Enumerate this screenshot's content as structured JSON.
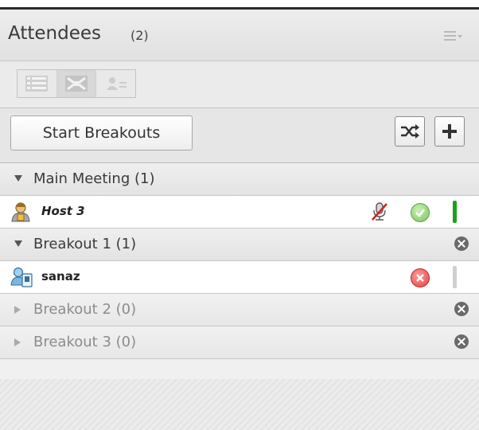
{
  "header": {
    "title": "Attendees",
    "count": "(2)",
    "menu_icon": "list-menu-icon"
  },
  "view_buttons": [
    {
      "name": "list-view-icon",
      "active": false
    },
    {
      "name": "breakout-view-icon",
      "active": true
    },
    {
      "name": "presenter-view-icon",
      "active": false
    }
  ],
  "actions": {
    "start_breakouts": "Start Breakouts",
    "shuffle_icon": "shuffle-icon",
    "add_icon": "plus-icon"
  },
  "groups": [
    {
      "label": "Main Meeting (1)",
      "expanded": true
    },
    {
      "label": "Breakout 1 (1)",
      "expanded": true
    },
    {
      "label": "Breakout 2 (0)",
      "expanded": false
    },
    {
      "label": "Breakout 3 (0)",
      "expanded": false
    }
  ],
  "users": [
    {
      "name": "Host 3",
      "role": "host",
      "mic": "muted",
      "status": "ok",
      "status_color": "#1aa21a"
    },
    {
      "name": "sanaz",
      "role": "participant",
      "status": "no",
      "status_color": "#cfcfcf"
    }
  ]
}
